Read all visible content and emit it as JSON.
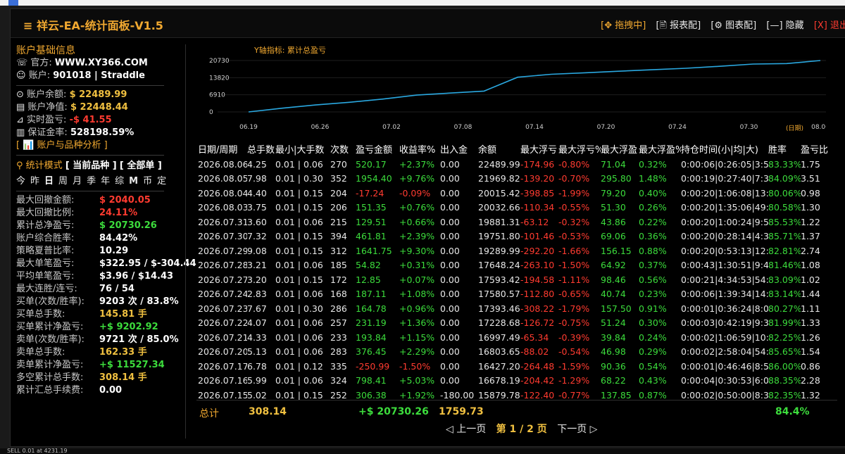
{
  "os": {
    "status_line": "SELL 0.01 at 4231.19"
  },
  "panel": {
    "title": "≡ 祥云-EA-统计面板-V1.5",
    "tools": {
      "drag": "[✥ 拖拽中]",
      "report": "[🖹 报表配]",
      "chart": "[⚙ 图表配]",
      "hide": "[—] 隐藏",
      "exit": "[X] 退出"
    }
  },
  "account": {
    "section_title": "账户基础信息",
    "site_label": "官方:",
    "site": "WWW.XY366.COM",
    "account_label": "账户:",
    "account": "901018 | Straddle",
    "balance_label": "账户余额:",
    "balance": "$ 22489.99",
    "equity_label": "账户净值:",
    "equity": "$ 22448.44",
    "floating_label": "实时盈亏:",
    "floating": "-$ 41.55",
    "margin_label": "保证金率:",
    "margin": "528198.59%",
    "analysis_link": "[ 📊 账户与品种分析 ]"
  },
  "stats_mode": {
    "label": "统计模式",
    "current": "[ 当前品种 ]",
    "all": "[ 全部单 ]",
    "periods": [
      "今",
      "昨",
      "日",
      "周",
      "月",
      "季",
      "年",
      "综",
      "M",
      "币",
      "定"
    ]
  },
  "stats": [
    {
      "label": "最大回撤金额:",
      "value": "$ 2040.05",
      "color": "red"
    },
    {
      "label": "最大回撤比例:",
      "value": "24.11%",
      "color": "red"
    },
    {
      "label": "累计总净盈亏:",
      "value": "$ 20730.26",
      "color": "green"
    },
    {
      "label": "账户综合胜率:",
      "value": "84.42%",
      "color": "white"
    },
    {
      "label": "策略夏普比率:",
      "value": "10.29",
      "color": "white"
    },
    {
      "label": "最大单笔盈亏:",
      "value": "$322.95 / $-304.44",
      "color": "white"
    },
    {
      "label": "平均单笔盈亏:",
      "value": "$3.96 / $14.43",
      "color": "white"
    },
    {
      "label": "最大连胜/连亏:",
      "value": "76 / 54",
      "color": "white"
    },
    {
      "label": "买单(次数/胜率):",
      "value": "9203 次 / 83.8%",
      "color": "white"
    },
    {
      "label": "买单总手数:",
      "value": "145.81 手",
      "color": "yellow"
    },
    {
      "label": "买单累计净盈亏:",
      "value": "+$ 9202.92",
      "color": "green"
    },
    {
      "label": "卖单(次数/胜率):",
      "value": "9721 次 / 85.0%",
      "color": "white"
    },
    {
      "label": "卖单总手数:",
      "value": "162.33 手",
      "color": "yellow"
    },
    {
      "label": "卖单累计净盈亏:",
      "value": "+$ 11527.34",
      "color": "green"
    },
    {
      "label": "多空累计总手数:",
      "value": "308.14 手",
      "color": "yellow"
    },
    {
      "label": "累计汇总手续费:",
      "value": "0.00",
      "color": "white"
    }
  ],
  "chart_data": {
    "type": "line",
    "ytitle": "Y轴指标: 累计总盈亏",
    "xlabel": "(日期)",
    "x": [
      "06.19",
      "06.26",
      "07.02",
      "07.08",
      "07.14",
      "07.20",
      "07.24",
      "07.30",
      "08.06"
    ],
    "y_ticks": [
      0,
      6910,
      13820,
      20730
    ],
    "ylim": [
      0,
      20730
    ],
    "values": [
      0,
      1500,
      2800,
      3900,
      5200,
      6800,
      7600,
      8400,
      14000,
      15200,
      15800,
      16400,
      17000,
      17600,
      18400,
      19300,
      19500,
      20730
    ],
    "line_color": "#2aa8e0"
  },
  "table": {
    "headers": [
      "日期/周期",
      "总手数",
      "最小|大手数",
      "次数",
      "盈亏金额",
      "收益率%",
      "出入金",
      "余额",
      "最大浮亏",
      "最大浮亏%",
      "最大浮盈",
      "最大浮盈%",
      "持仓时间(小|均|大)",
      "胜率",
      "盈亏比"
    ],
    "rows": [
      [
        "2026.08.06",
        "4.25",
        "0.01 | 0.06",
        "270",
        "520.17",
        "+2.37%",
        "0.00",
        "22489.99",
        "-174.96",
        "-0.80%",
        "71.04",
        "0.32%",
        "0:00:06|0:26:05|3:59:30",
        "83.33%",
        "1.75"
      ],
      [
        "2026.08.05",
        "7.98",
        "0.01 | 0.30",
        "352",
        "1954.40",
        "+9.76%",
        "0.00",
        "21969.82",
        "-139.20",
        "-0.70%",
        "295.80",
        "1.48%",
        "0:00:19|0:27:40|7:39:44",
        "84.09%",
        "3.51"
      ],
      [
        "2026.08.04",
        "4.40",
        "0.01 | 0.15",
        "204",
        "-17.24",
        "-0.09%",
        "0.00",
        "20015.42",
        "-398.85",
        "-1.99%",
        "79.20",
        "0.40%",
        "0:00:20|1:06:08|13:28:00",
        "80.06%",
        "0.98"
      ],
      [
        "2026.08.03",
        "3.75",
        "0.01 | 0.15",
        "206",
        "151.35",
        "+0.76%",
        "0.00",
        "20032.66",
        "-110.34",
        "-0.55%",
        "51.30",
        "0.26%",
        "0:00:20|1:35:06|49:20:40",
        "80.58%",
        "1.30"
      ],
      [
        "2026.07.31",
        "3.60",
        "0.01 | 0.06",
        "215",
        "129.51",
        "+0.66%",
        "0.00",
        "19881.31",
        "-63.12",
        "-0.32%",
        "43.86",
        "0.22%",
        "0:00:20|1:00:24|9:51:15",
        "85.53%",
        "1.22"
      ],
      [
        "2026.07.30",
        "7.32",
        "0.01 | 0.15",
        "394",
        "461.81",
        "+2.39%",
        "0.00",
        "19751.80",
        "-101.46",
        "-0.53%",
        "69.06",
        "0.36%",
        "0:00:20|0:28:14|4:33:19",
        "85.71%",
        "1.37"
      ],
      [
        "2026.07.29",
        "9.08",
        "0.01 | 0.15",
        "312",
        "1641.75",
        "+9.30%",
        "0.00",
        "19289.99",
        "-292.20",
        "-1.66%",
        "156.15",
        "0.88%",
        "0:00:20|0:53:13|12:49:28",
        "82.81%",
        "2.74"
      ],
      [
        "2026.07.28",
        "3.21",
        "0.01 | 0.06",
        "185",
        "54.82",
        "+0.31%",
        "0.00",
        "17648.24",
        "-263.10",
        "-1.50%",
        "64.92",
        "0.37%",
        "0:00:43|1:30:51|9:40:11",
        "81.46%",
        "1.08"
      ],
      [
        "2026.07.27",
        "3.20",
        "0.01 | 0.15",
        "172",
        "12.85",
        "+0.07%",
        "0.00",
        "17593.42",
        "-194.58",
        "-1.11%",
        "98.46",
        "0.56%",
        "0:00:21|4:34:53|54:48:00",
        "83.09%",
        "1.02"
      ],
      [
        "2026.07.24",
        "2.83",
        "0.01 | 0.06",
        "168",
        "187.11",
        "+1.08%",
        "0.00",
        "17580.57",
        "-112.80",
        "-0.65%",
        "40.74",
        "0.23%",
        "0:00:06|1:39:34|14:40:31",
        "83.14%",
        "1.44"
      ],
      [
        "2026.07.23",
        "7.67",
        "0.01 | 0.30",
        "286",
        "164.78",
        "+0.96%",
        "0.00",
        "17393.46",
        "-308.22",
        "-1.79%",
        "157.50",
        "0.91%",
        "0:00:01|0:36:24|8:06:01",
        "80.27%",
        "1.11"
      ],
      [
        "2026.07.22",
        "4.07",
        "0.01 | 0.06",
        "257",
        "231.19",
        "+1.36%",
        "0.00",
        "17228.68",
        "-126.72",
        "-0.75%",
        "51.24",
        "0.30%",
        "0:00:03|0:42:19|9:35:51",
        "81.99%",
        "1.33"
      ],
      [
        "2026.07.21",
        "4.33",
        "0.01 | 0.06",
        "233",
        "193.84",
        "+1.15%",
        "0.00",
        "16997.49",
        "-65.34",
        "-0.39%",
        "39.84",
        "0.24%",
        "0:00:02|1:06:59|10:38:50",
        "82.25%",
        "1.26"
      ],
      [
        "2026.07.20",
        "5.13",
        "0.01 | 0.06",
        "283",
        "376.45",
        "+2.29%",
        "0.00",
        "16803.65",
        "-88.02",
        "-0.54%",
        "46.98",
        "0.29%",
        "0:00:02|2:58:04|54:35:56",
        "85.65%",
        "1.54"
      ],
      [
        "2026.07.17",
        "6.78",
        "0.01 | 0.12",
        "335",
        "-250.99",
        "-1.50%",
        "0.00",
        "16427.20",
        "-264.48",
        "-1.59%",
        "90.36",
        "0.54%",
        "0:00:01|0:46:46|8:59:30",
        "86.00%",
        "0.86"
      ],
      [
        "2026.07.16",
        "5.99",
        "0.01 | 0.06",
        "324",
        "798.41",
        "+5.03%",
        "0.00",
        "16678.19",
        "-204.42",
        "-1.29%",
        "68.22",
        "0.43%",
        "0:00:04|0:30:53|6:02:00",
        "88.35%",
        "2.28"
      ],
      [
        "2026.07.15",
        "5.02",
        "0.01 | 0.15",
        "252",
        "306.38",
        "+1.92%",
        "-180.00",
        "15879.78",
        "-122.40",
        "-0.77%",
        "137.85",
        "0.87%",
        "0:00:02|0:50:00|8:39:23",
        "82.35%",
        "1.32"
      ]
    ]
  },
  "totals": {
    "label": "总计",
    "lots": "308.14",
    "pnl": "+$ 20730.26",
    "funds": "1759.73",
    "winrate": "84.4%"
  },
  "pager": {
    "prev": "◁ 上一页",
    "page": "第 1 / 2 页",
    "next": "下一页 ▷"
  }
}
